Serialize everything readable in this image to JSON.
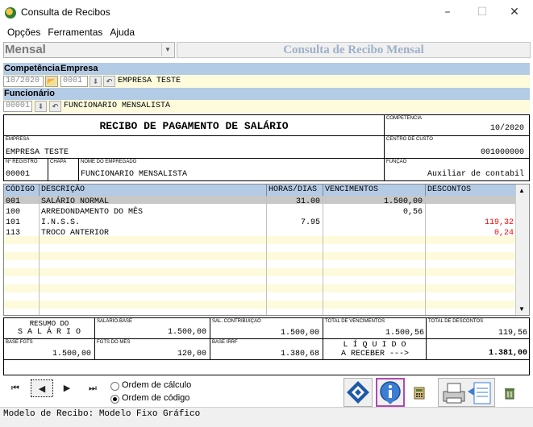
{
  "window": {
    "title": "Consulta de Recibos"
  },
  "menu": [
    "Opções",
    "Ferramentas",
    "Ajuda"
  ],
  "mode": {
    "value": "Mensal",
    "banner": "Consulta de Recibo Mensal"
  },
  "filters": {
    "competencia_label": "Competência",
    "empresa_label": "Empresa",
    "competencia_value": "10/2020",
    "empresa_code": "0001",
    "empresa_name": "EMPRESA TESTE",
    "funcionario_label": "Funcionário",
    "funcionario_code": "00001",
    "funcionario_name": "FUNCIONARIO MENSALISTA"
  },
  "receipt": {
    "title": "RECIBO DE PAGAMENTO DE SALÁRIO",
    "competencia_cap": "COMPETÊNCIA",
    "competencia": "10/2020",
    "empresa_cap": "EMPRESA",
    "empresa": "EMPRESA TESTE",
    "centro_cap": "CENTRO DE CUSTO",
    "centro": "001000000",
    "registro_cap": "Nº REGISTRO",
    "registro": "00001",
    "chapa_cap": "CHAPA",
    "nome_cap": "NOME DO EMPREGADO",
    "nome": "FUNCIONARIO MENSALISTA",
    "funcao_cap": "FUNÇÃO",
    "funcao": "Auxiliar de contabil"
  },
  "grid": {
    "headers": [
      "CÓDIGO",
      "DESCRIÇÃO",
      "HORAS/DIAS",
      "VENCIMENTOS",
      "DESCONTOS"
    ],
    "rows": [
      {
        "codigo": "001",
        "descricao": "SALÁRIO NORMAL",
        "horas": "31.00",
        "venc": "1.500,00",
        "desc": ""
      },
      {
        "codigo": "100",
        "descricao": "ARREDONDAMENTO DO MÊS",
        "horas": "",
        "venc": "0,56",
        "desc": ""
      },
      {
        "codigo": "101",
        "descricao": "I.N.S.S.",
        "horas": "7.95",
        "venc": "",
        "desc": "119,32"
      },
      {
        "codigo": "113",
        "descricao": "TROCO ANTERIOR",
        "horas": "",
        "venc": "",
        "desc": "0,24"
      }
    ]
  },
  "summary": {
    "resumo1": "RESUMO DO",
    "resumo2": "S A L Á R I O",
    "salario_base_cap": "SALÁRIO-BASE",
    "salario_base": "1.500,00",
    "sal_contrib_cap": "SAL. CONTRIBUIÇÃO",
    "sal_contrib": "1.500,00",
    "total_venc_cap": "TOTAL DE VENCIMENTOS",
    "total_venc": "1.500,56",
    "total_desc_cap": "TOTAL DE DESCONTOS",
    "total_desc": "119,56",
    "base_fgts_cap": "BASE FGTS",
    "base_fgts": "1.500,00",
    "fgts_mes_cap": "FGTS DO MÊS",
    "fgts_mes": "120,00",
    "base_irrf_cap": "BASE IRRF",
    "base_irrf": "1.380,68",
    "liquido1": "L Í Q U I D O",
    "liquido2": "A RECEBER --->",
    "liquido": "1.381,00"
  },
  "ordering": {
    "opt1": "Ordem de cálculo",
    "opt2": "Ordem de código",
    "selected": "Ordem de código"
  },
  "status": "Modelo de Recibo: Modelo Fixo Gráfico",
  "colors": {
    "blue_header": "#b4cbe6",
    "yellow_row": "#fdfbdc",
    "discount_red": "#ff0000",
    "highlight_purple": "#b04ab0"
  }
}
